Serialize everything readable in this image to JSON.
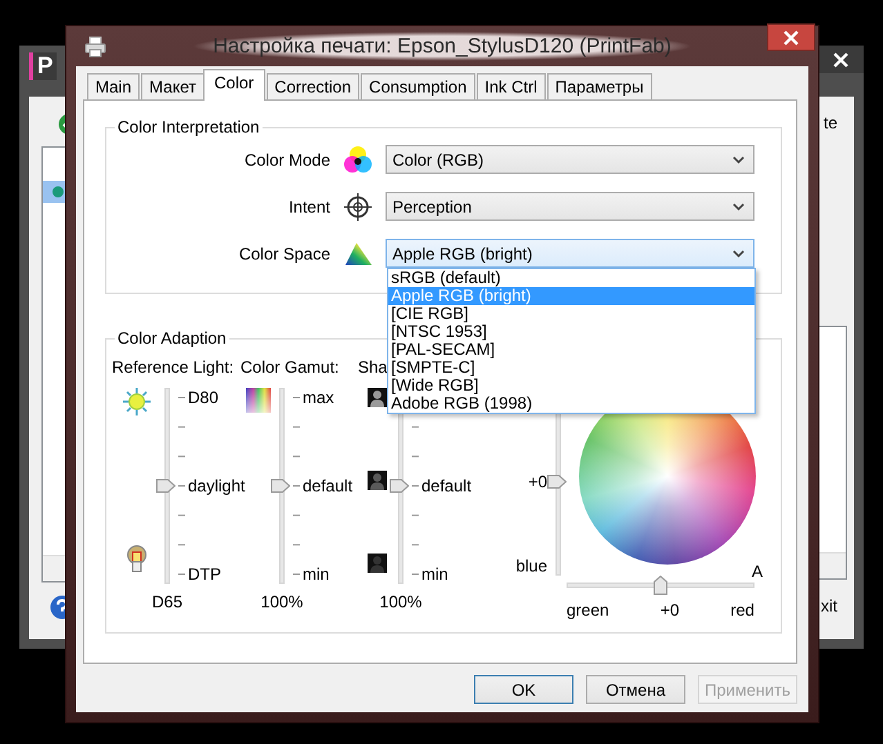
{
  "background_window": {
    "app_icon_letter": "P",
    "list_rows": [
      {
        "selected": false
      },
      {
        "selected": true
      }
    ],
    "right_buttons": [
      "te",
      "xit"
    ]
  },
  "dialog": {
    "title": "Настройка печати: Epson_StylusD120 (PrintFab)",
    "tabs": [
      {
        "label": "Main",
        "selected": false
      },
      {
        "label": "Макет",
        "selected": false
      },
      {
        "label": "Color",
        "selected": true
      },
      {
        "label": "Correction",
        "selected": false
      },
      {
        "label": "Consumption",
        "selected": false
      },
      {
        "label": "Ink Ctrl",
        "selected": false
      },
      {
        "label": "Параметры",
        "selected": false
      }
    ],
    "color_interpretation": {
      "title": "Color Interpretation",
      "rows": [
        {
          "kind": "mode",
          "label": "Color Mode",
          "value": "Color (RGB)",
          "focused": false
        },
        {
          "kind": "intent",
          "label": "Intent",
          "value": "Perception",
          "focused": false
        },
        {
          "kind": "space",
          "label": "Color Space",
          "value": "Apple RGB (bright)",
          "focused": true
        }
      ]
    },
    "dropdown": {
      "items": [
        {
          "label": "sRGB (default)",
          "selected": false
        },
        {
          "label": "Apple RGB (bright)",
          "selected": true
        },
        {
          "label": "[CIE RGB]",
          "selected": false
        },
        {
          "label": "[NTSC 1953]",
          "selected": false
        },
        {
          "label": "[PAL-SECAM]",
          "selected": false
        },
        {
          "label": "[SMPTE-C]",
          "selected": false
        },
        {
          "label": "[Wide RGB]",
          "selected": false
        },
        {
          "label": "Adobe RGB (1998)",
          "selected": false
        }
      ]
    },
    "color_adaption": {
      "title": "Color Adaption",
      "sliders": [
        {
          "kind": "light",
          "heading": "Reference Light:",
          "top": "D80",
          "middle": "daylight",
          "bottom": "DTP",
          "level": 0.5,
          "value": "D65"
        },
        {
          "kind": "gamut",
          "heading": "Color Gamut:",
          "top": "max",
          "middle": "default",
          "bottom": "min",
          "level": 0.5,
          "value": "100%"
        },
        {
          "kind": "shadow",
          "heading": "Sha",
          "middle": "default",
          "bottom": "min",
          "level": 0.5,
          "value": "100%"
        }
      ],
      "tint": {
        "vertical": {
          "value": "+0",
          "bottom": "blue",
          "level": 0.5
        },
        "corner_label": "A",
        "horizontal": {
          "left": "green",
          "value": "+0",
          "right": "red",
          "level": 0.5
        }
      }
    },
    "buttons": [
      {
        "label": "OK",
        "default": true,
        "disabled": false
      },
      {
        "label": "Отмена",
        "default": false,
        "disabled": false
      },
      {
        "label": "Применить",
        "default": false,
        "disabled": true
      }
    ]
  }
}
